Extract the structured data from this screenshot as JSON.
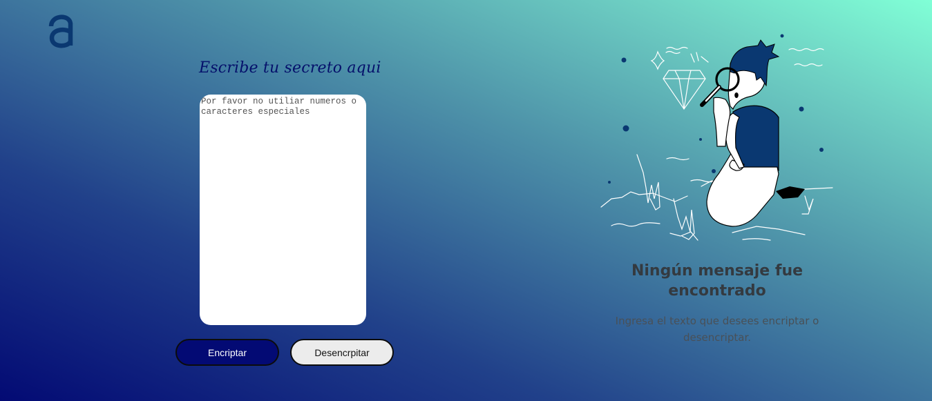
{
  "logo": {
    "icon": "alura-logo-icon",
    "color": "#0a3871"
  },
  "editor": {
    "heading": "Escribe tu secreto aqui",
    "placeholder": "Por favor no utiliar numeros o caracteres especiales",
    "value": ""
  },
  "buttons": {
    "encrypt_label": "Encriptar",
    "decrypt_label": "Desencrpitar"
  },
  "output": {
    "illustration_icon": "person-magnifying-glass-illustration",
    "title": "Ningún mensaje fue encontrado",
    "subtitle": "Ingresa el texto que desees encriptar o desencriptar."
  },
  "colors": {
    "primary": "#030a74",
    "gradient_start": "#030a74",
    "gradient_end": "#80ffd6",
    "secondary_button": "#ececec",
    "title_text": "#343a40"
  }
}
